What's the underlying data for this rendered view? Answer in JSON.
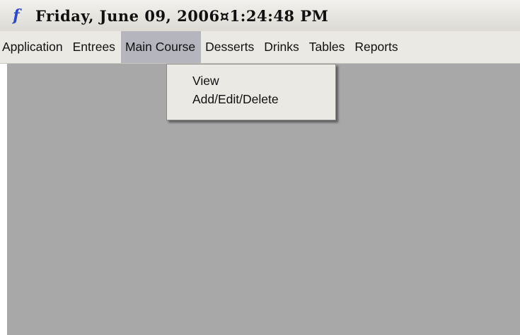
{
  "title_bar": {
    "icon": "f",
    "icon_name": "app-f-icon",
    "title": "Friday, June 09, 2006¤1:24:48 PM"
  },
  "menubar": {
    "items": [
      {
        "label": "Application"
      },
      {
        "label": "Entrees"
      },
      {
        "label": "Main Course",
        "active": true
      },
      {
        "label": "Desserts"
      },
      {
        "label": "Drinks"
      },
      {
        "label": "Tables"
      },
      {
        "label": "Reports"
      }
    ]
  },
  "dropdown": {
    "items": [
      {
        "label": "View"
      },
      {
        "label": "Add/Edit/Delete"
      }
    ]
  },
  "colors": {
    "workspace": "#a8a8a8",
    "menu_background": "#ebe9e4",
    "active_menu_background": "#b5b5bd",
    "icon": "#2f48c8"
  }
}
